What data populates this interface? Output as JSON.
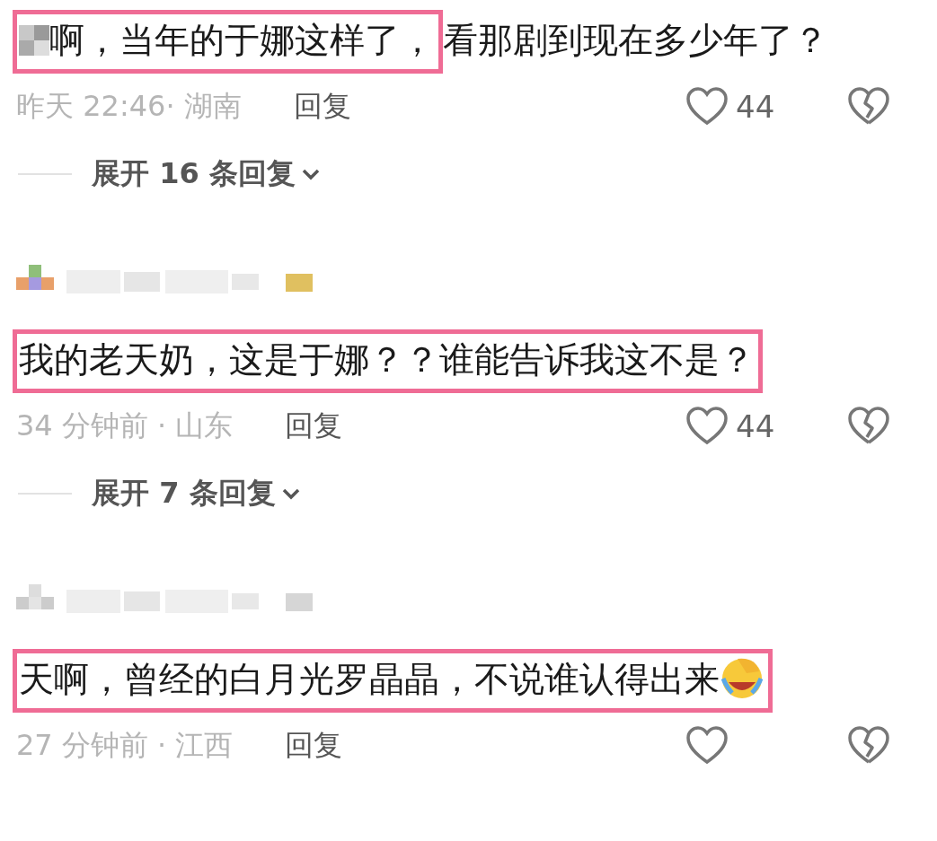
{
  "comments": [
    {
      "username_blurred": false,
      "redacted_prefix": true,
      "highlight": "啊，当年的于娜这样了，",
      "text": "看那剧到现在多少年了？",
      "trailing_emoji": false,
      "time_place": "昨天 22:46· 湖南",
      "reply": "回复",
      "likes": "44",
      "expand": "展开 16 条回复"
    },
    {
      "username_blurred": true,
      "redacted_prefix": false,
      "highlight": "我的老天奶，这是于娜？？谁能告诉我这不是？",
      "trailing_emoji": false,
      "time_place": "34 分钟前 · 山东",
      "reply": "回复",
      "likes": "44",
      "expand": "展开 7 条回复"
    },
    {
      "username_blurred": true,
      "redacted_prefix": false,
      "highlight": "天啊，曾经的白月光罗晶晶，不说谁认得出来",
      "trailing_emoji": true,
      "time_place": "27 分钟前 · 江西",
      "reply": "回复"
    }
  ]
}
